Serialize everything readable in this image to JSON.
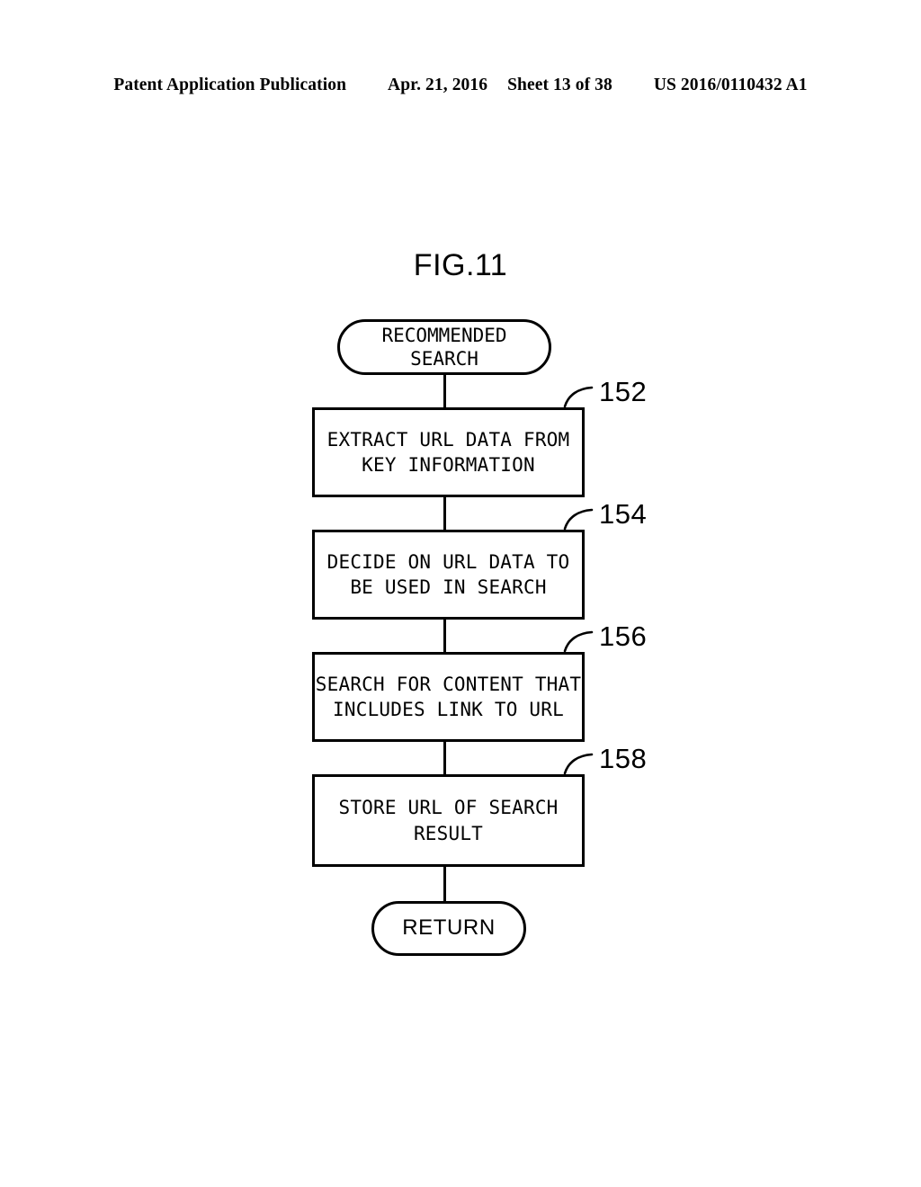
{
  "header": {
    "publication": "Patent Application Publication",
    "date": "Apr. 21, 2016",
    "sheet": "Sheet 13 of 38",
    "patent_number": "US 2016/0110432 A1"
  },
  "figure": {
    "title": "FIG.11"
  },
  "flowchart": {
    "start": {
      "label": "RECOMMENDED\nSEARCH",
      "shape": "terminal"
    },
    "steps": [
      {
        "ref": "152",
        "label": "EXTRACT URL DATA FROM\nKEY INFORMATION",
        "shape": "process"
      },
      {
        "ref": "154",
        "label": "DECIDE ON URL DATA TO\nBE USED IN SEARCH",
        "shape": "process"
      },
      {
        "ref": "156",
        "label": "SEARCH FOR CONTENT THAT\nINCLUDES LINK TO URL",
        "shape": "process"
      },
      {
        "ref": "158",
        "label": "STORE URL OF SEARCH\nRESULT",
        "shape": "process"
      }
    ],
    "end": {
      "label": "RETURN",
      "shape": "terminal"
    },
    "line_color": "#000000",
    "background_color": "#ffffff"
  }
}
